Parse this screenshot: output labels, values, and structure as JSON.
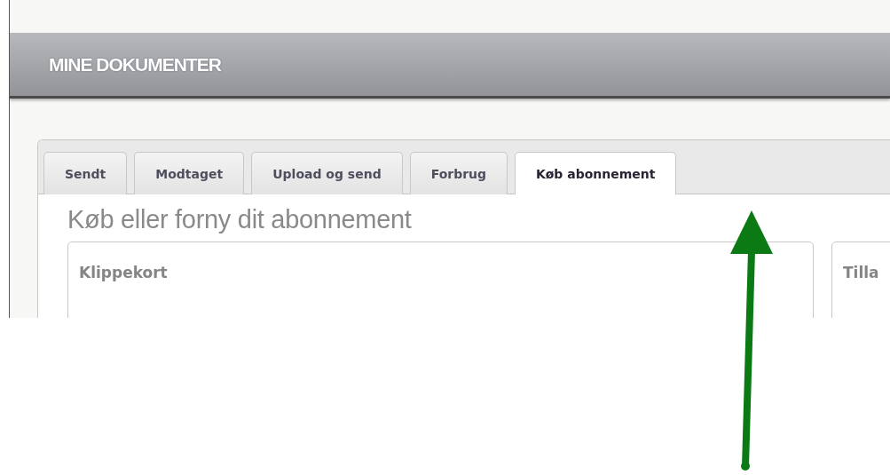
{
  "header": {
    "title": "MINE DOKUMENTER"
  },
  "tabs": [
    {
      "label": "Sendt",
      "selected": false
    },
    {
      "label": "Modtaget",
      "selected": false
    },
    {
      "label": "Upload og send",
      "selected": false
    },
    {
      "label": "Forbrug",
      "selected": false
    },
    {
      "label": "Køb abonnement",
      "selected": true
    }
  ],
  "heading": "Køb eller forny dit abonnement",
  "cards": [
    {
      "title": "Klippekort"
    },
    {
      "title": "Tilla"
    }
  ]
}
